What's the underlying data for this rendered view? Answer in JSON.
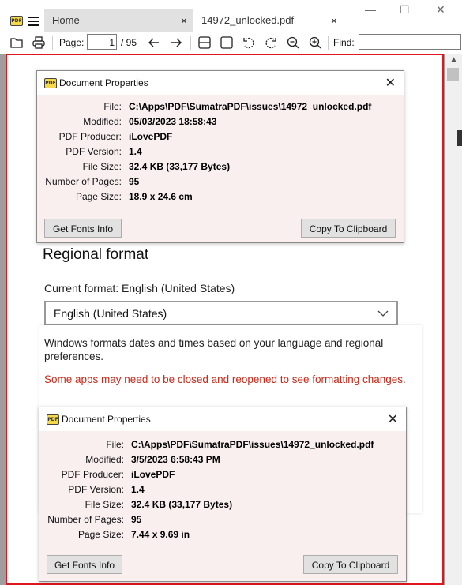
{
  "titlebar": {
    "tabs": [
      {
        "label": "Home",
        "close": "×"
      },
      {
        "label": "14972_unlocked.pdf",
        "close": "×"
      }
    ],
    "window_controls": {
      "minimize": "—",
      "maximize": "☐",
      "close": "✕"
    }
  },
  "toolbar": {
    "page_label": "Page:",
    "page_value": "1",
    "page_total": "/ 95",
    "find_label": "Find:",
    "icons": [
      "open-folder-icon",
      "print-icon",
      "back-arrow-icon",
      "forward-arrow-icon",
      "single-page-icon",
      "fit-page-icon",
      "rotate-left-icon",
      "rotate-right-icon",
      "zoom-out-icon",
      "zoom-in-icon"
    ]
  },
  "dialog_top": {
    "title": "Document Properties",
    "logo_text": "PDF",
    "properties": [
      {
        "label": "File:",
        "value": "C:\\Apps\\PDF\\SumatraPDF\\issues\\14972_unlocked.pdf"
      },
      {
        "label": "Modified:",
        "value": "05/03/2023 18:58:43"
      },
      {
        "label": "PDF Producer:",
        "value": "iLovePDF"
      },
      {
        "label": "PDF Version:",
        "value": "1.4"
      },
      {
        "label": "File Size:",
        "value": "32.4 KB (33,177 Bytes)"
      },
      {
        "label": "Number of Pages:",
        "value": "95"
      },
      {
        "label": "Page Size:",
        "value": "18.9 x 24.6 cm"
      }
    ],
    "buttons": {
      "fonts": "Get Fonts Info",
      "copy": "Copy To Clipboard"
    }
  },
  "settings": {
    "heading": "Regional format",
    "current_format_label": "Current format: English (United States)",
    "combo_value": "English (United States)",
    "description": "Windows formats dates and times based on your language and regional preferences.",
    "warning": "Some apps may need to be closed and reopened to see formatting changes."
  },
  "dialog_bottom": {
    "title": "Document Properties",
    "logo_text": "PDF",
    "properties": [
      {
        "label": "File:",
        "value": "C:\\Apps\\PDF\\SumatraPDF\\issues\\14972_unlocked.pdf"
      },
      {
        "label": "Modified:",
        "value": "3/5/2023 6:58:43 PM"
      },
      {
        "label": "PDF Producer:",
        "value": "iLovePDF"
      },
      {
        "label": "PDF Version:",
        "value": "1.4"
      },
      {
        "label": "File Size:",
        "value": "32.4 KB (33,177 Bytes)"
      },
      {
        "label": "Number of Pages:",
        "value": "95"
      },
      {
        "label": "Page Size:",
        "value": "7.44 x 9.69 in"
      }
    ],
    "buttons": {
      "fonts": "Get Fonts Info",
      "copy": "Copy To Clipboard"
    }
  },
  "colors": {
    "page_border": "#e0161e",
    "warning_text": "#c42b1c",
    "dialog_bg": "#f9efef",
    "logo_yellow": "#f6d94a"
  }
}
